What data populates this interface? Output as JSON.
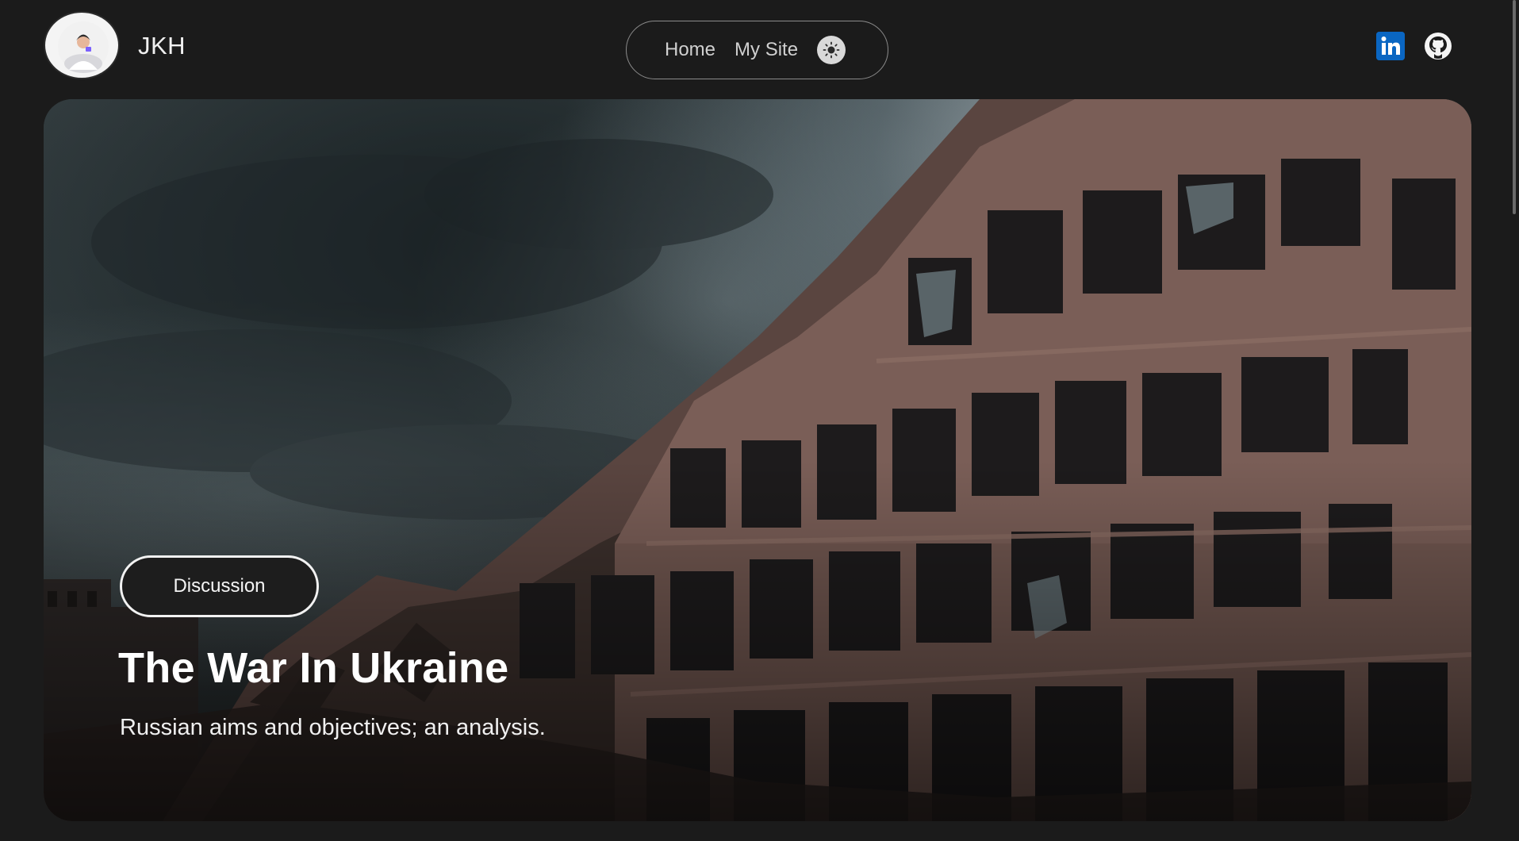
{
  "header": {
    "brand": "JKH",
    "nav": [
      {
        "label": "Home"
      },
      {
        "label": "My Site"
      }
    ],
    "icons": {
      "avatar": "avatar-illustration",
      "theme_toggle": "sun-icon",
      "linkedin": "linkedin-icon",
      "github": "github-icon"
    }
  },
  "hero": {
    "tag": "Discussion",
    "title": "The War In Ukraine",
    "subtitle": "Russian aims and objectives; an analysis.",
    "image": "ruined-building-under-stormy-sky"
  },
  "colors": {
    "background": "#1b1b1b",
    "linkedin": "#0a66c2",
    "button_bg": "#1d1d1d",
    "text": "#ffffff"
  }
}
